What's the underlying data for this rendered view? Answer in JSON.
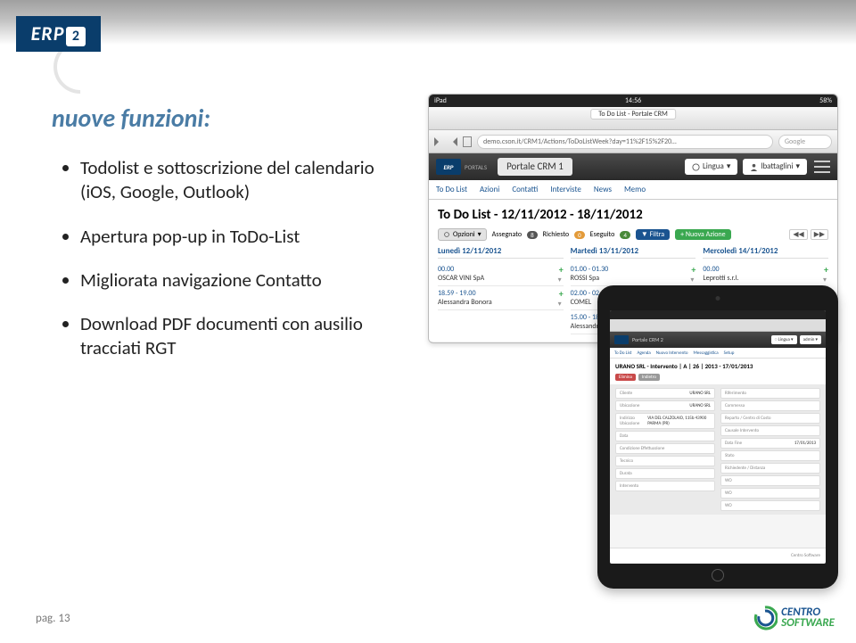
{
  "title": "nuove funzioni:",
  "bullets": [
    "Todolist e sottoscrizione del calendario (iOS, Google, Outlook)",
    "Apertura pop-up  in ToDo-List",
    "Migliorata navigazione Contatto",
    "Download  PDF documenti con ausilio tracciati RGT"
  ],
  "logo": {
    "erp": "ERP",
    "two": "2"
  },
  "footer": {
    "page": "pag. 13",
    "brand1": "CENTRO",
    "brand2": "SOFTWARE"
  },
  "shot1": {
    "status": {
      "left": "iPad",
      "center": "14:56",
      "right": "58%"
    },
    "tabtitle": "To Do List - Portale CRM",
    "url": "demo.cson.it/CRM1/Actions/ToDoListWeek?day=11%2F15%2F20…",
    "goo": "Google",
    "portal": "Portale CRM 1",
    "portals": "PORTALS",
    "topbtn": {
      "lingua": "Lingua",
      "user": "lbattaglini"
    },
    "tabs": [
      "To Do List",
      "Azioni",
      "Contatti",
      "Interviste",
      "News",
      "Memo"
    ],
    "heading": "To Do List - 12/11/2012 - 18/11/2012",
    "filters": {
      "opz": "Opzioni",
      "ass": "Assegnato",
      "assn": "8",
      "ric": "Richiesto",
      "ricn": "0",
      "ese": "Eseguito",
      "esen": "4",
      "fil": "Filtra",
      "new": "+ Nuova Azione"
    },
    "days": [
      {
        "h": "Lunedì 12/11/2012",
        "ev": [
          {
            "t": "00.00",
            "c": "OSCAR VINI SpA"
          },
          {
            "t": "18.59 - 19.00",
            "c": "Alessandra Bonora"
          }
        ]
      },
      {
        "h": "Martedì 13/11/2012",
        "ev": [
          {
            "t": "01.00 - 01.30",
            "c": "ROSSI Spa"
          },
          {
            "t": "02.00 - 02",
            "c": "COMEL"
          },
          {
            "t": "15.00 - 18",
            "c": "Alessandra"
          }
        ]
      },
      {
        "h": "Mercoledì 14/11/2012",
        "ev": [
          {
            "t": "00.00",
            "c": "Leprotti s.r.l."
          }
        ]
      }
    ]
  },
  "ipad": {
    "portal": "Portale CRM 2",
    "tabs": [
      "To Do List",
      "Agenda",
      "Nuovo Intervento",
      "Messaggistica",
      "Setup"
    ],
    "heading": "URANO SRL - Intervento | A | 26 | 2013 - 17/01/2013",
    "btns": {
      "del": "Elimina",
      "ind": "Indietro"
    },
    "left": [
      {
        "l": "Cliente",
        "v": "URANO SRL"
      },
      {
        "l": "Ubicazione",
        "v": "URANO SRL"
      },
      {
        "l": "Indirizzo Ubicazione",
        "v": "VIA DEL CALZOLAIO, 115b 43900 PARMA (PR)"
      },
      {
        "l": "Data",
        "v": ""
      },
      {
        "l": "Condizione Effettuazione",
        "v": ""
      },
      {
        "l": "Tecnico",
        "v": ""
      },
      {
        "l": "Durata",
        "v": ""
      },
      {
        "l": "Intervento",
        "v": ""
      }
    ],
    "right": [
      {
        "l": "Riferimento",
        "v": ""
      },
      {
        "l": "Commessa",
        "v": ""
      },
      {
        "l": "Reparto / Centro di Costo",
        "v": ""
      },
      {
        "l": "Causale Intervento",
        "v": ""
      },
      {
        "l": "Data Fine",
        "v": "17/01/2013"
      },
      {
        "l": "Stato",
        "v": ""
      },
      {
        "l": "Richiedente / Distanza",
        "v": ""
      },
      {
        "l": "WO",
        "v": ""
      },
      {
        "l": "WO",
        "v": ""
      },
      {
        "l": "WO",
        "v": ""
      }
    ],
    "foot": "Centro Software"
  }
}
